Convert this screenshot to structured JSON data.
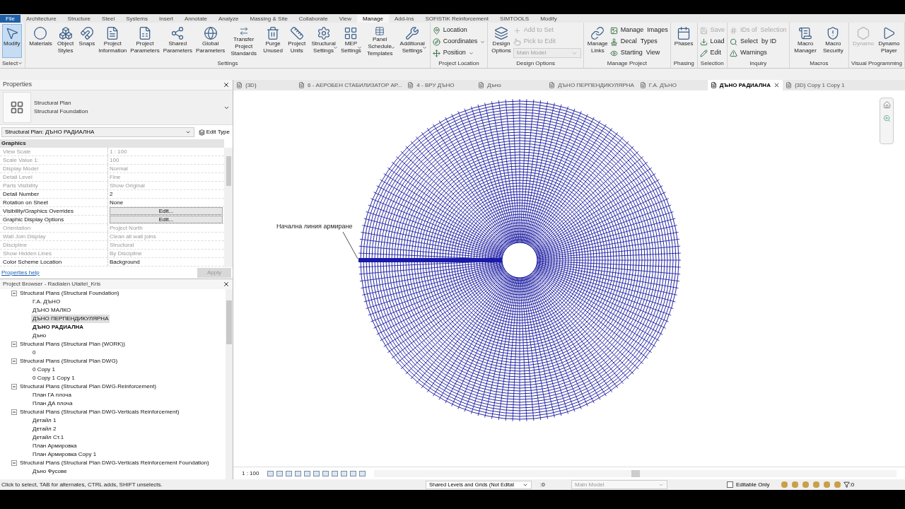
{
  "menu_tabs": [
    {
      "label": "File",
      "selected": false
    },
    {
      "label": "Architecture",
      "selected": false
    },
    {
      "label": "Structure",
      "selected": false
    },
    {
      "label": "Steel",
      "selected": false
    },
    {
      "label": "Systems",
      "selected": false
    },
    {
      "label": "Insert",
      "selected": false
    },
    {
      "label": "Annotate",
      "selected": false
    },
    {
      "label": "Analyze",
      "selected": false
    },
    {
      "label": "Massing & Site",
      "selected": false
    },
    {
      "label": "Collaborate",
      "selected": false
    },
    {
      "label": "View",
      "selected": false
    },
    {
      "label": "Manage",
      "selected": true
    },
    {
      "label": "Add-Ins",
      "selected": false
    },
    {
      "label": "SOFiSTiK Reinforcement",
      "selected": false
    },
    {
      "label": "SIMTOOLS",
      "selected": false
    },
    {
      "label": "Modify",
      "selected": false
    }
  ],
  "ribbon": [
    {
      "label": "Select",
      "has_menu": true,
      "items": [
        {
          "kind": "large",
          "label": "Modify",
          "selected": true,
          "disabled": false
        }
      ]
    },
    {
      "label": "Settings",
      "items": [
        {
          "kind": "large",
          "label": "Materials",
          "selected": false,
          "disabled": false
        },
        {
          "kind": "large",
          "label": "Object Styles",
          "selected": false,
          "disabled": false
        },
        {
          "kind": "large",
          "label": "Snaps",
          "selected": false,
          "disabled": false
        },
        {
          "kind": "large",
          "label": "Project Information",
          "selected": false,
          "disabled": false
        },
        {
          "kind": "large",
          "label": "Project Parameters",
          "selected": false,
          "disabled": false
        },
        {
          "kind": "large",
          "label": "Shared Parameters",
          "selected": false,
          "disabled": false
        },
        {
          "kind": "large",
          "label": "Global Parameters",
          "selected": false,
          "disabled": false
        },
        {
          "kind": "large",
          "label": "Transfer Project Standards",
          "selected": false,
          "disabled": false
        },
        {
          "kind": "large",
          "label": "Purge Unused",
          "selected": false,
          "disabled": false
        },
        {
          "kind": "large",
          "label": "Project Units",
          "selected": false,
          "disabled": false
        },
        {
          "kind": "large",
          "label": "Structural Settings",
          "selected": false,
          "disabled": false,
          "has_menu": true
        },
        {
          "kind": "large",
          "label": "MEP Settings",
          "selected": false,
          "disabled": false,
          "has_menu": true
        },
        {
          "kind": "large",
          "label": "Panel Schedule Templates",
          "selected": false,
          "disabled": false,
          "has_menu": true
        },
        {
          "kind": "large",
          "label": "Additional Settings",
          "selected": false,
          "disabled": false,
          "has_menu": true
        }
      ]
    },
    {
      "label": "Project Location",
      "items": [
        {
          "kind": "small",
          "label": "Location",
          "disabled": false
        },
        {
          "kind": "small",
          "label": "Coordinates",
          "disabled": false,
          "has_menu": true
        },
        {
          "kind": "small",
          "label": "Position",
          "disabled": false,
          "has_menu": true
        }
      ]
    },
    {
      "label": "Design Options",
      "items": [
        {
          "kind": "large",
          "label": "Design Options",
          "selected": false,
          "disabled": false
        },
        {
          "kind": "small",
          "label": "Add to Set",
          "disabled": true
        },
        {
          "kind": "small",
          "label": "Pick to Edit",
          "disabled": true
        },
        {
          "kind": "dropdown",
          "label": "Main Model",
          "disabled": true
        }
      ]
    },
    {
      "label": "Manage Project",
      "items": [
        {
          "kind": "large",
          "label": "Manage Links",
          "selected": false,
          "disabled": false
        },
        {
          "kind": "small",
          "label": "Manage  Images",
          "disabled": false
        },
        {
          "kind": "small",
          "label": "Decal  Types",
          "disabled": false
        },
        {
          "kind": "small",
          "label": "Starting  View",
          "disabled": false
        }
      ]
    },
    {
      "label": "Phasing",
      "items": [
        {
          "kind": "large",
          "label": "Phases",
          "selected": false,
          "disabled": false
        }
      ]
    },
    {
      "label": "Selection",
      "items": [
        {
          "kind": "small",
          "label": "Save",
          "disabled": true
        },
        {
          "kind": "small",
          "label": "Load",
          "disabled": false
        },
        {
          "kind": "small",
          "label": "Edit",
          "disabled": false
        }
      ]
    },
    {
      "label": "Inquiry",
      "items": [
        {
          "kind": "small",
          "label": "IDs of  Selection",
          "disabled": true
        },
        {
          "kind": "small",
          "label": "Select  by ID",
          "disabled": false
        },
        {
          "kind": "small",
          "label": "Warnings",
          "disabled": false
        }
      ]
    },
    {
      "label": "Macros",
      "items": [
        {
          "kind": "large",
          "label": "Macro Manager",
          "selected": false,
          "disabled": false
        },
        {
          "kind": "large",
          "label": "Macro Security",
          "selected": false,
          "disabled": false
        }
      ]
    },
    {
      "label": "Visual Programming",
      "items": [
        {
          "kind": "large",
          "label": "Dynamo",
          "selected": false,
          "disabled": true
        },
        {
          "kind": "large",
          "label": "Dynamo Player",
          "selected": false,
          "disabled": false
        }
      ]
    }
  ],
  "properties": {
    "title": "Properties",
    "type_line_1": "Structural Plan",
    "type_line_2": "Structural Foundation",
    "instance": "Structural Plan: ДЪНО РАДИАЛНА",
    "edit_type": "Edit Type",
    "group": "Graphics",
    "rows": [
      {
        "name": "View Scale",
        "value": "1 : 100",
        "kind": "text",
        "disabled": true
      },
      {
        "name": "Scale Value    1:",
        "value": "100",
        "kind": "text",
        "disabled": true
      },
      {
        "name": "Display Model",
        "value": "Normal",
        "kind": "text",
        "disabled": true
      },
      {
        "name": "Detail Level",
        "value": "Fine",
        "kind": "text",
        "disabled": true
      },
      {
        "name": "Parts Visibility",
        "value": "Show Original",
        "kind": "text",
        "disabled": true
      },
      {
        "name": "Detail Number",
        "value": "2",
        "kind": "text",
        "disabled": false
      },
      {
        "name": "Rotation on Sheet",
        "value": "None",
        "kind": "text",
        "disabled": false
      },
      {
        "name": "Visibility/Graphics Overrides",
        "value": "Edit...",
        "kind": "button",
        "disabled": false
      },
      {
        "name": "Graphic Display Options",
        "value": "Edit...",
        "kind": "button",
        "disabled": false
      },
      {
        "name": "Orientation",
        "value": "Project North",
        "kind": "text",
        "disabled": true
      },
      {
        "name": "Wall Join Display",
        "value": "Clean all wall joins",
        "kind": "text",
        "disabled": true
      },
      {
        "name": "Discipline",
        "value": "Structural",
        "kind": "text",
        "disabled": true
      },
      {
        "name": "Show Hidden Lines",
        "value": "By Discipline",
        "kind": "text",
        "disabled": true
      },
      {
        "name": "Color Scheme Location",
        "value": "Background",
        "kind": "text",
        "disabled": false
      }
    ],
    "help": "Properties help",
    "apply": {
      "label": "Apply",
      "disabled": true
    }
  },
  "browser": {
    "title": "Project Browser - Radialen Utaitel_Kris",
    "tree": [
      {
        "label": "Structural Plans (Structural Foundation)",
        "expanded": true,
        "children": [
          {
            "label": "Г.А. ДЪНО",
            "selected": false,
            "active": false
          },
          {
            "label": "ДЪНО МАЛКО",
            "selected": false,
            "active": false
          },
          {
            "label": "ДЪНО ПЕРПЕНДИКУЛЯРНА",
            "selected": true,
            "active": false
          },
          {
            "label": "ДЪНО РАДИАЛНА",
            "selected": false,
            "active": true
          },
          {
            "label": "Дъно",
            "selected": false,
            "active": false
          }
        ]
      },
      {
        "label": "Structural Plans (Structural Plan (WORK))",
        "expanded": true,
        "children": [
          {
            "label": "0",
            "selected": false,
            "active": false
          }
        ]
      },
      {
        "label": "Structural Plans (Structural Plan DWG)",
        "expanded": true,
        "children": [
          {
            "label": "0 Copy 1",
            "selected": false,
            "active": false
          },
          {
            "label": "0 Copy 1 Copy 1",
            "selected": false,
            "active": false
          }
        ]
      },
      {
        "label": "Structural Plans (Structural Plan DWG-Reinforcement)",
        "expanded": true,
        "children": [
          {
            "label": "План ГА плоча",
            "selected": false,
            "active": false
          },
          {
            "label": "План ДА плоча",
            "selected": false,
            "active": false
          }
        ]
      },
      {
        "label": "Structural Plans (Structural Plan DWG-Verticals Reinforcement)",
        "expanded": true,
        "children": [
          {
            "label": "Детайл 1",
            "selected": false,
            "active": false
          },
          {
            "label": "Детайл 2",
            "selected": false,
            "active": false
          },
          {
            "label": "Детайл Ст.1",
            "selected": false,
            "active": false
          },
          {
            "label": "План Армировка",
            "selected": false,
            "active": false
          },
          {
            "label": "План Армировка Copy 1",
            "selected": false,
            "active": false
          }
        ]
      },
      {
        "label": "Structural Plans (Structural Plan DWG-Verticals Reinforcement Foundation)",
        "expanded": true,
        "children": [
          {
            "label": "Дъно Фусове",
            "selected": false,
            "active": false
          }
        ]
      }
    ]
  },
  "view_tabs": [
    {
      "label": "{3D}",
      "selected": false
    },
    {
      "label": "6 - АЕРОБЕН СТАБИЛИЗАТОР АР...",
      "selected": false
    },
    {
      "label": "4 - ВРУ ДЪНО",
      "selected": false
    },
    {
      "label": "Дъно",
      "selected": false
    },
    {
      "label": "ДЪНО ПЕРПЕНДИКУЛЯРНА",
      "selected": false
    },
    {
      "label": "Г.А. ДЪНО",
      "selected": false
    },
    {
      "label": "ДЪНО РАДИАЛНА",
      "selected": true
    },
    {
      "label": "{3D} Copy 1 Copy 1",
      "selected": false
    }
  ],
  "canvas": {
    "annotation": "Начална линия армиране"
  },
  "view_bar": {
    "scale": "1 : 100"
  },
  "status": {
    "hint": "Click to select, TAB for alternates, CTRL adds, SHIFT unselects.",
    "workset": "Shared Levels and Grids (Not Editat",
    "workset_count": ":0",
    "design_option": "Main Model",
    "editable_only": {
      "label": "Editable Only",
      "checked": false
    },
    "filter_count": ":0"
  }
}
